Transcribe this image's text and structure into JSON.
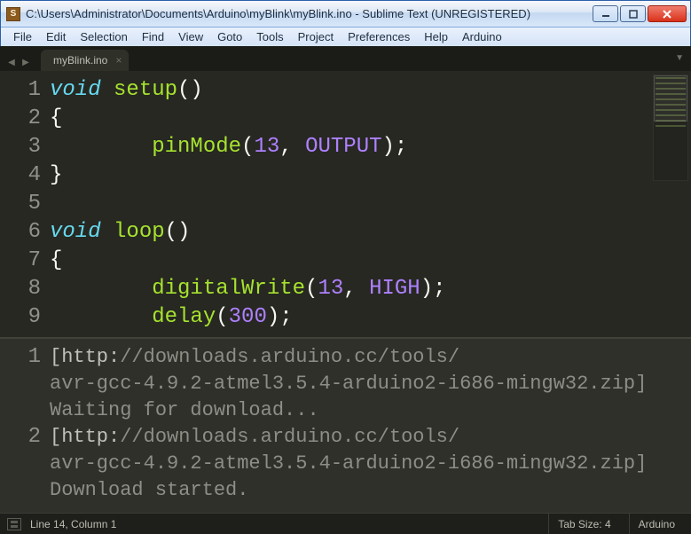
{
  "window": {
    "title": "C:\\Users\\Administrator\\Documents\\Arduino\\myBlink\\myBlink.ino - Sublime Text (UNREGISTERED)"
  },
  "menu": {
    "items": [
      "File",
      "Edit",
      "Selection",
      "Find",
      "View",
      "Goto",
      "Tools",
      "Project",
      "Preferences",
      "Help",
      "Arduino"
    ]
  },
  "tabs": {
    "items": [
      {
        "label": "myBlink.ino"
      }
    ]
  },
  "code": {
    "lines": [
      {
        "n": "1",
        "tokens": [
          {
            "t": "void ",
            "c": "kw"
          },
          {
            "t": "setup",
            "c": "fn"
          },
          {
            "t": "()",
            "c": "plain"
          }
        ]
      },
      {
        "n": "2",
        "tokens": [
          {
            "t": "{",
            "c": "plain"
          }
        ]
      },
      {
        "n": "3",
        "tokens": [
          {
            "t": "        ",
            "c": "plain"
          },
          {
            "t": "pinMode",
            "c": "fn"
          },
          {
            "t": "(",
            "c": "plain"
          },
          {
            "t": "13",
            "c": "num"
          },
          {
            "t": ", ",
            "c": "plain"
          },
          {
            "t": "OUTPUT",
            "c": "const"
          },
          {
            "t": ");",
            "c": "plain"
          }
        ]
      },
      {
        "n": "4",
        "tokens": [
          {
            "t": "}",
            "c": "plain"
          }
        ]
      },
      {
        "n": "5",
        "tokens": []
      },
      {
        "n": "6",
        "tokens": [
          {
            "t": "void ",
            "c": "kw"
          },
          {
            "t": "loop",
            "c": "fn"
          },
          {
            "t": "()",
            "c": "plain"
          }
        ]
      },
      {
        "n": "7",
        "tokens": [
          {
            "t": "{",
            "c": "plain"
          }
        ]
      },
      {
        "n": "8",
        "tokens": [
          {
            "t": "        ",
            "c": "plain"
          },
          {
            "t": "digitalWrite",
            "c": "fn"
          },
          {
            "t": "(",
            "c": "plain"
          },
          {
            "t": "13",
            "c": "num"
          },
          {
            "t": ", ",
            "c": "plain"
          },
          {
            "t": "HIGH",
            "c": "const"
          },
          {
            "t": ");",
            "c": "plain"
          }
        ]
      },
      {
        "n": "9",
        "tokens": [
          {
            "t": "        ",
            "c": "plain"
          },
          {
            "t": "delay",
            "c": "fn"
          },
          {
            "t": "(",
            "c": "plain"
          },
          {
            "t": "300",
            "c": "num"
          },
          {
            "t": ");",
            "c": "plain"
          }
        ]
      }
    ]
  },
  "output": {
    "entries": [
      {
        "n": "1",
        "scheme": "[http:",
        "rest1": "//downloads.arduino.cc/tools/",
        "line2": "avr-gcc-4.9.2-atmel3.5.4-arduino2-i686-mingw32.zip]",
        "line3": "Waiting for download..."
      },
      {
        "n": "2",
        "scheme": "[http:",
        "rest1": "//downloads.arduino.cc/tools/",
        "line2": "avr-gcc-4.9.2-atmel3.5.4-arduino2-i686-mingw32.zip]",
        "line3": "Download started."
      }
    ]
  },
  "status": {
    "position": "Line 14, Column 1",
    "tabsize": "Tab Size: 4",
    "syntax": "Arduino"
  },
  "icons": {
    "app_letter": "S"
  }
}
